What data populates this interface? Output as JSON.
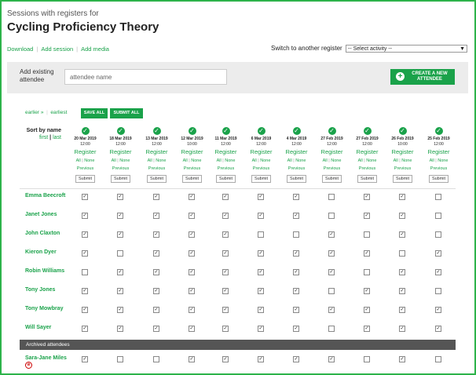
{
  "header": {
    "pre_title": "Sessions with registers for",
    "title": "Cycling Proficiency Theory",
    "links": [
      "Download",
      "Add session",
      "Add media"
    ],
    "switch_label": "Switch to another register",
    "switch_value": "-- Select activity --"
  },
  "add": {
    "label": "Add existing attendee",
    "placeholder": "attendee name",
    "create_label": "CREATE A NEW ATTENDEE"
  },
  "nav": {
    "earlier": "earlier »",
    "earliest": "earliest",
    "save_all": "SAVE ALL",
    "submit_all": "SUBMIT ALL"
  },
  "sort": {
    "label": "Sort by name",
    "first": "first",
    "sep": "|",
    "last": "last"
  },
  "session_labels": {
    "register": "Register",
    "all": "All",
    "none": "None",
    "previous": "Previous",
    "submit": "Submit"
  },
  "sessions": [
    {
      "date": "20 Mar 2019",
      "time": "12:00"
    },
    {
      "date": "18 Mar 2019",
      "time": "12:00"
    },
    {
      "date": "13 Mar 2019",
      "time": "12:00"
    },
    {
      "date": "12 Mar 2019",
      "time": "10:00"
    },
    {
      "date": "11 Mar 2019",
      "time": "12:00"
    },
    {
      "date": "6 Mar 2019",
      "time": "12:00"
    },
    {
      "date": "4 Mar 2019",
      "time": "12:00"
    },
    {
      "date": "27 Feb 2019",
      "time": "12:00"
    },
    {
      "date": "27 Feb 2019",
      "time": "12:00"
    },
    {
      "date": "26 Feb 2019",
      "time": "10:00"
    },
    {
      "date": "25 Feb 2019",
      "time": "12:00"
    }
  ],
  "attendees": [
    {
      "name": "Emma Beecroft",
      "attendance": [
        1,
        1,
        1,
        1,
        1,
        1,
        1,
        0,
        1,
        1,
        0
      ]
    },
    {
      "name": "Janet Jones",
      "attendance": [
        1,
        1,
        1,
        1,
        1,
        1,
        1,
        0,
        1,
        1,
        0
      ]
    },
    {
      "name": "John Claxton",
      "attendance": [
        1,
        1,
        1,
        1,
        1,
        0,
        0,
        1,
        0,
        1,
        0
      ]
    },
    {
      "name": "Kieron Dyer",
      "attendance": [
        1,
        0,
        1,
        1,
        1,
        1,
        1,
        1,
        1,
        0,
        1
      ]
    },
    {
      "name": "Robin Williams",
      "attendance": [
        0,
        1,
        1,
        1,
        1,
        1,
        1,
        1,
        0,
        1,
        1
      ]
    },
    {
      "name": "Tony Jones",
      "attendance": [
        1,
        1,
        1,
        1,
        1,
        1,
        1,
        0,
        1,
        1,
        0
      ]
    },
    {
      "name": "Tony Mowbray",
      "attendance": [
        1,
        1,
        1,
        1,
        1,
        1,
        1,
        1,
        1,
        1,
        1
      ]
    },
    {
      "name": "Will Sayer",
      "attendance": [
        1,
        1,
        1,
        1,
        1,
        1,
        1,
        0,
        1,
        1,
        1
      ]
    }
  ],
  "archived": {
    "heading": "Archived attendees",
    "attendees": [
      {
        "name": "Sara-Jane Miles",
        "attendance": [
          1,
          0,
          0,
          1,
          1,
          1,
          1,
          1,
          0,
          1,
          0
        ]
      }
    ]
  }
}
